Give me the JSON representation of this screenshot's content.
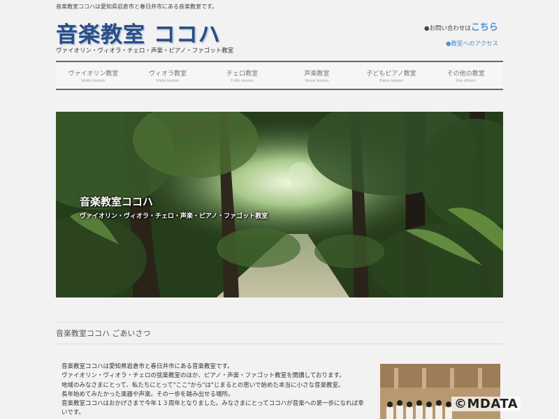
{
  "header": {
    "tagline": "音楽教室ココハは愛知県岩倉市と春日井市にある音楽教室です。",
    "logo_text": "音楽教室 ココハ",
    "logo_sub": "ヴァイオリン・ヴィオラ・チェロ・声楽・ピアノ・ファゴット教室",
    "contact_prefix": "●お問い合わせは",
    "contact_link": "こちら",
    "access_link": "●教室へのアクセス"
  },
  "nav": {
    "items": [
      {
        "jp": "ヴァイオリン教室",
        "en": "Violin lesson"
      },
      {
        "jp": "ヴィオラ教室",
        "en": "Viola lesson"
      },
      {
        "jp": "チェロ教室",
        "en": "Cello lesson"
      },
      {
        "jp": "声楽教室",
        "en": "Voice lesson"
      },
      {
        "jp": "子どもピアノ教室",
        "en": "Piano lesson"
      },
      {
        "jp": "その他の教室",
        "en": "the others"
      }
    ]
  },
  "hero": {
    "title": "音楽教室ココハ",
    "subtitle": "ヴァイオリン・ヴィオラ・チェロ・声楽・ピアノ・ファゴット教室"
  },
  "greeting": {
    "heading": "音楽教室ココハ ごあいさつ",
    "lines": [
      "音楽教室ココハは愛知県岩倉市と春日井市にある音楽教室です。",
      "ヴァイオリン・ヴィオラ・チェロの弦楽教室のほか、ピアノ・声楽・ファゴット教室を開講しております。",
      "地域のみなさまにとって、私たちにとって\"ここ\"から\"は\"じまるとの思いで始めた本当に小さな音楽教室。",
      "長年始めてみたかった楽器や声楽。その一歩を踏み出せる場所。",
      "音楽教室ココハはおかげさまで今年１３周年となりました。みなさまにとってココハが音楽への第一歩になれば幸",
      "いです。"
    ]
  },
  "watermark": "©MDATA"
}
